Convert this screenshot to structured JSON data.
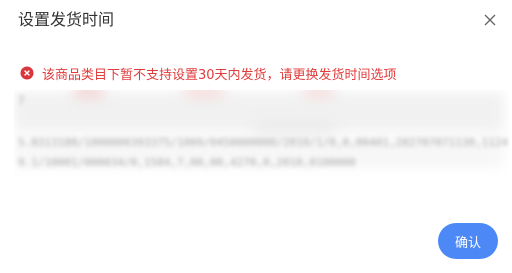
{
  "dialog": {
    "title": "设置发货时间",
    "close_icon": "close-icon"
  },
  "alert": {
    "icon": "error-circle-icon",
    "text": "该商品类目下暂不支持设置30天内发货，请更换发货时间选项",
    "color": "#e03c3c"
  },
  "blurred_content": {
    "line1": "7",
    "line2": "5.8313188/1000000393375/1009/0450000000/2010/1/0,0,00401,202707071130,1124",
    "line3": "9.1/10001/000034/0,1584,7,00,00,4270,0,2010,0100000"
  },
  "footer": {
    "confirm_label": "确认",
    "confirm_color": "#4c88f6"
  }
}
